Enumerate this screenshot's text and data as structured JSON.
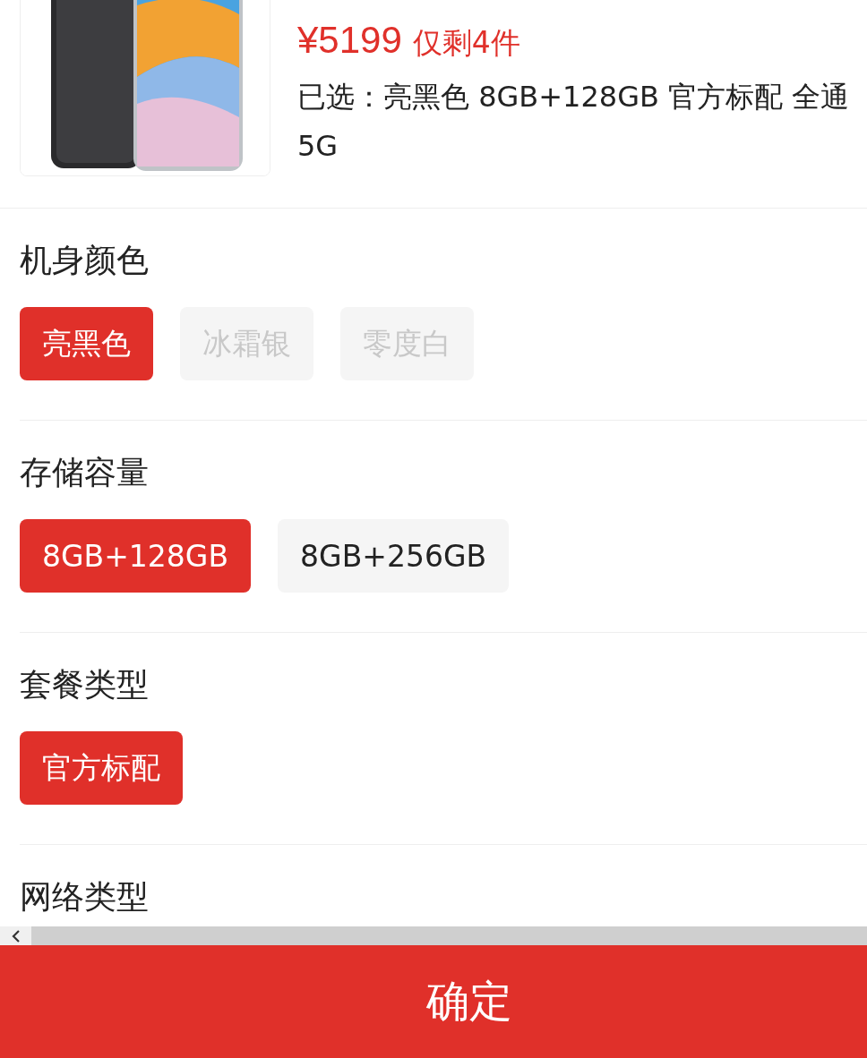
{
  "product": {
    "price": "¥5199",
    "stock": "仅剩4件",
    "selected_summary": "已选：亮黑色 8GB+128GB 官方标配 全通5G"
  },
  "option_groups": [
    {
      "title": "机身颜色",
      "options": [
        {
          "label": "亮黑色",
          "selected": true,
          "disabled": false
        },
        {
          "label": "冰霜银",
          "selected": false,
          "disabled": true
        },
        {
          "label": "零度白",
          "selected": false,
          "disabled": true
        }
      ]
    },
    {
      "title": "存储容量",
      "options": [
        {
          "label": "8GB+128GB",
          "selected": true,
          "disabled": false
        },
        {
          "label": "8GB+256GB",
          "selected": false,
          "disabled": false
        }
      ]
    },
    {
      "title": "套餐类型",
      "options": [
        {
          "label": "官方标配",
          "selected": true,
          "disabled": false
        }
      ]
    },
    {
      "title": "网络类型"
    }
  ],
  "confirm_button": "确定"
}
